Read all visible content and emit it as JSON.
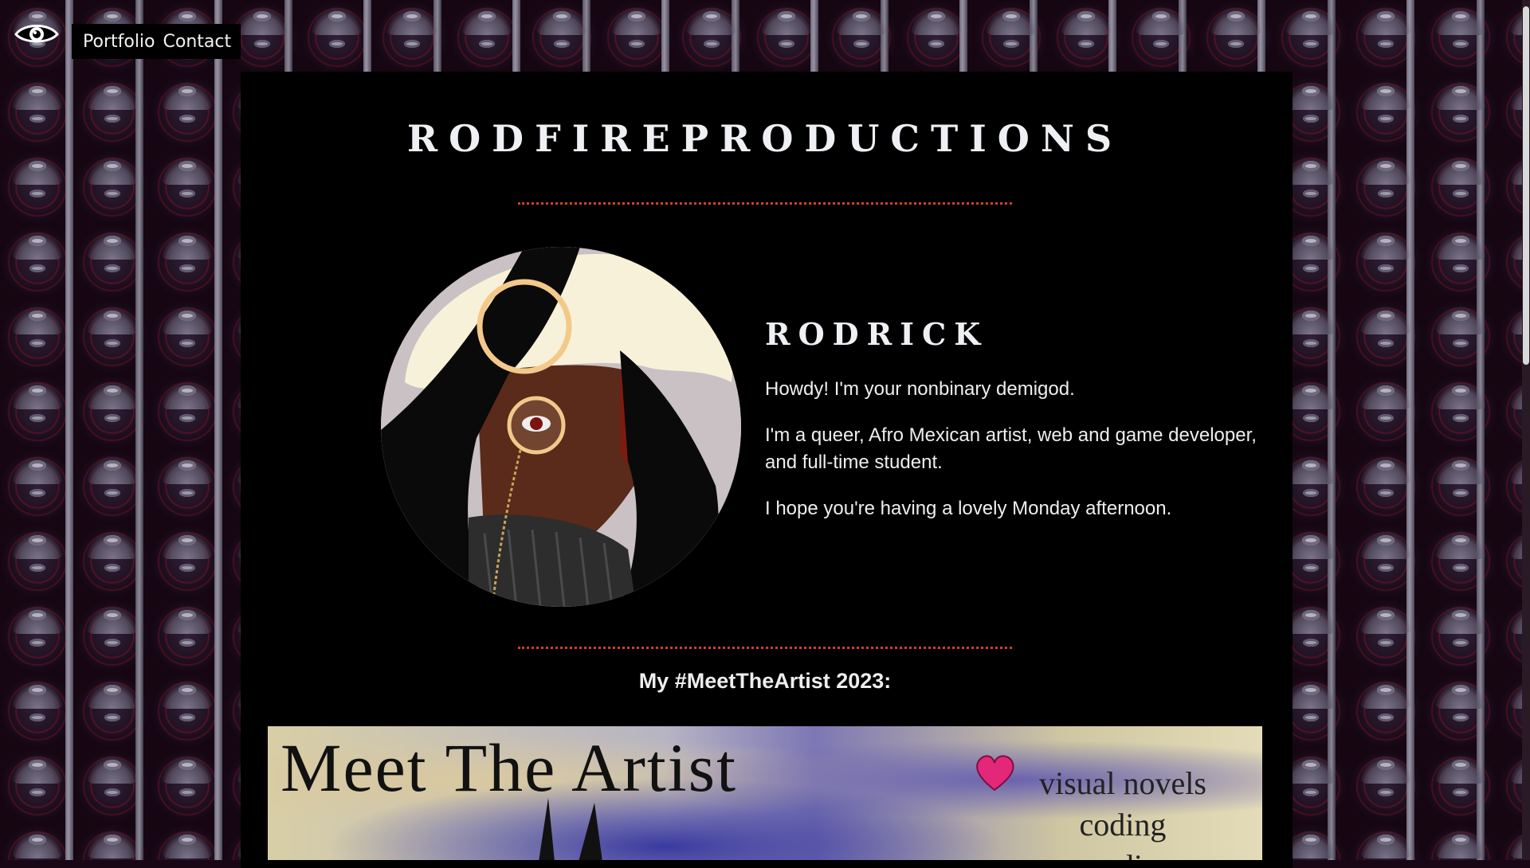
{
  "nav": {
    "links": [
      "Portfolio",
      "Contact"
    ]
  },
  "site": {
    "title": "RODFIREPRODUCTIONS"
  },
  "profile": {
    "name": "RODRICK",
    "paragraphs": [
      "Howdy! I'm your nonbinary demigod.",
      "I'm a queer, Afro Mexican artist, web and game developer, and full-time student.",
      "I hope you're having a lovely Monday afternoon."
    ]
  },
  "meet_the_artist": {
    "heading": "My #MeetTheArtist 2023:",
    "image_title": "Meet The Artist",
    "image_list": [
      "visual novels",
      "coding",
      "readi..."
    ]
  },
  "colors": {
    "accent": "#d0402f",
    "panel": "#000000",
    "text": "#eeeeee"
  },
  "icons": {
    "logo": "eye-logo-icon",
    "heart": "heart-icon"
  }
}
